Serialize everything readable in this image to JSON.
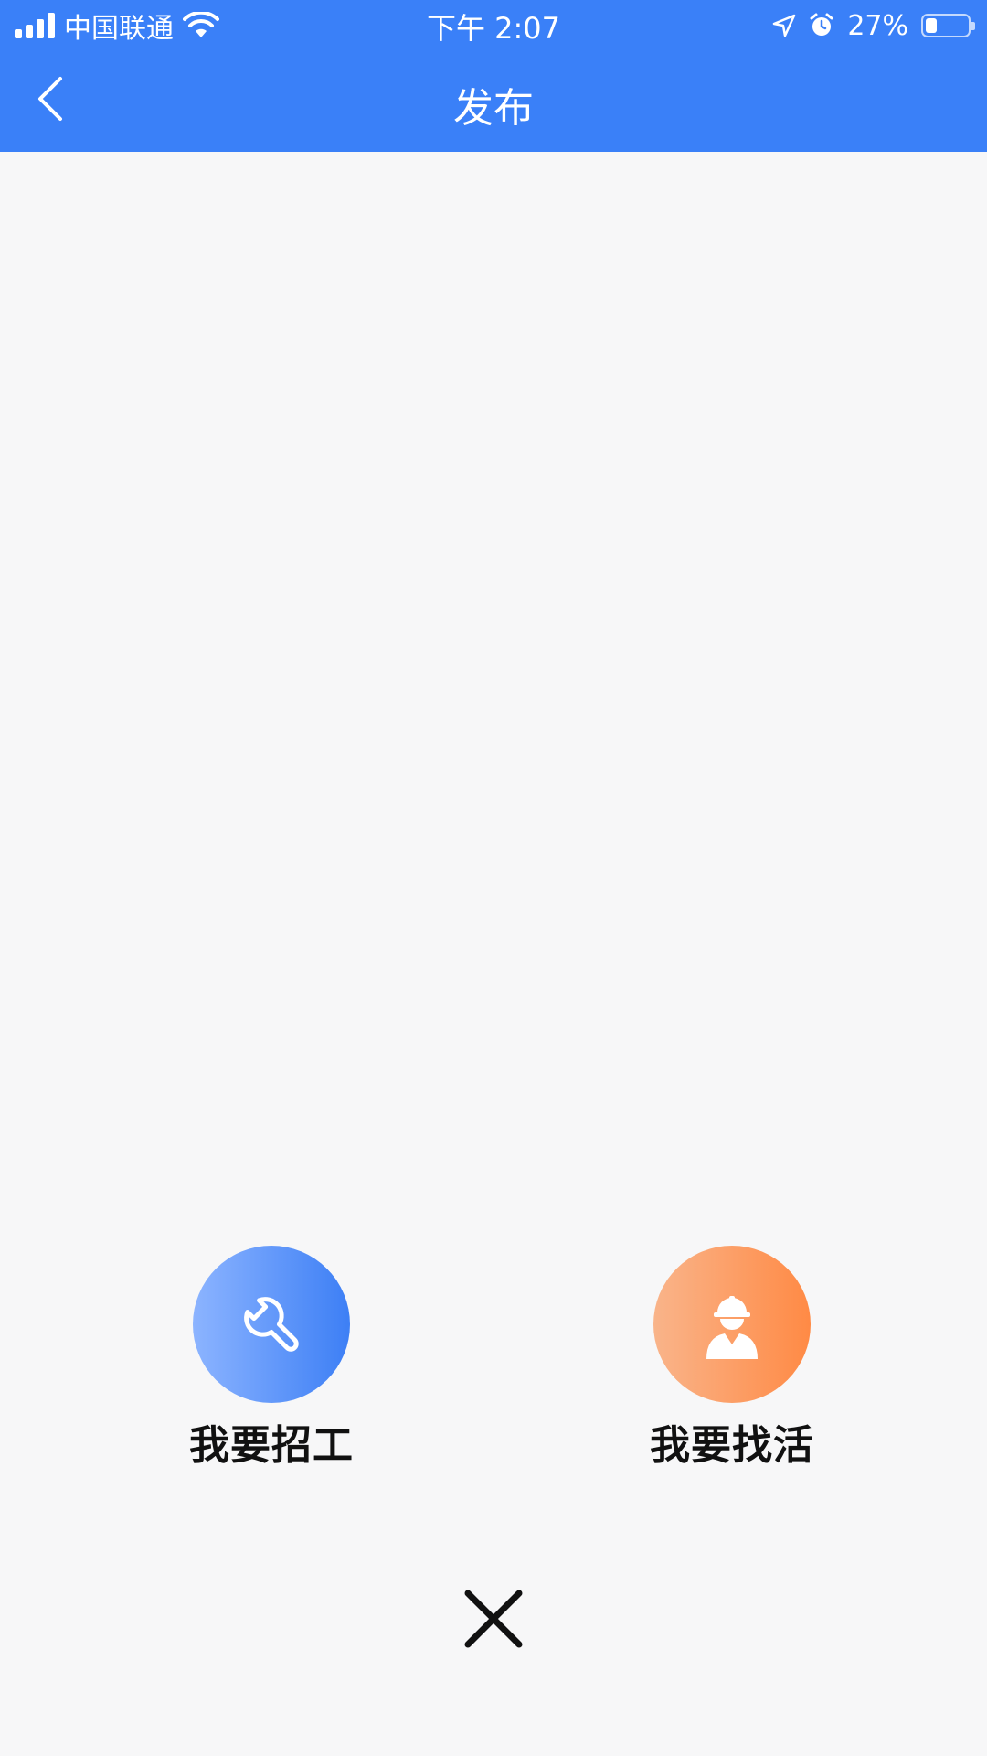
{
  "status_bar": {
    "carrier": "中国联通",
    "time": "下午 2:07",
    "battery": "27%",
    "battery_level": 0.27
  },
  "header": {
    "title": "发布",
    "back_icon": "chevron-left-icon"
  },
  "actions": [
    {
      "label": "我要招工",
      "icon": "wrench-icon",
      "gradient": [
        "#8cb4ff",
        "#3d7ff5"
      ]
    },
    {
      "label": "我要找活",
      "icon": "worker-hardhat-icon",
      "gradient": [
        "#f9b48a",
        "#ff8a45"
      ]
    }
  ],
  "close_icon": "close-icon",
  "colors": {
    "primary": "#3a80f8",
    "background": "#f7f7f8",
    "text": "#111111"
  }
}
